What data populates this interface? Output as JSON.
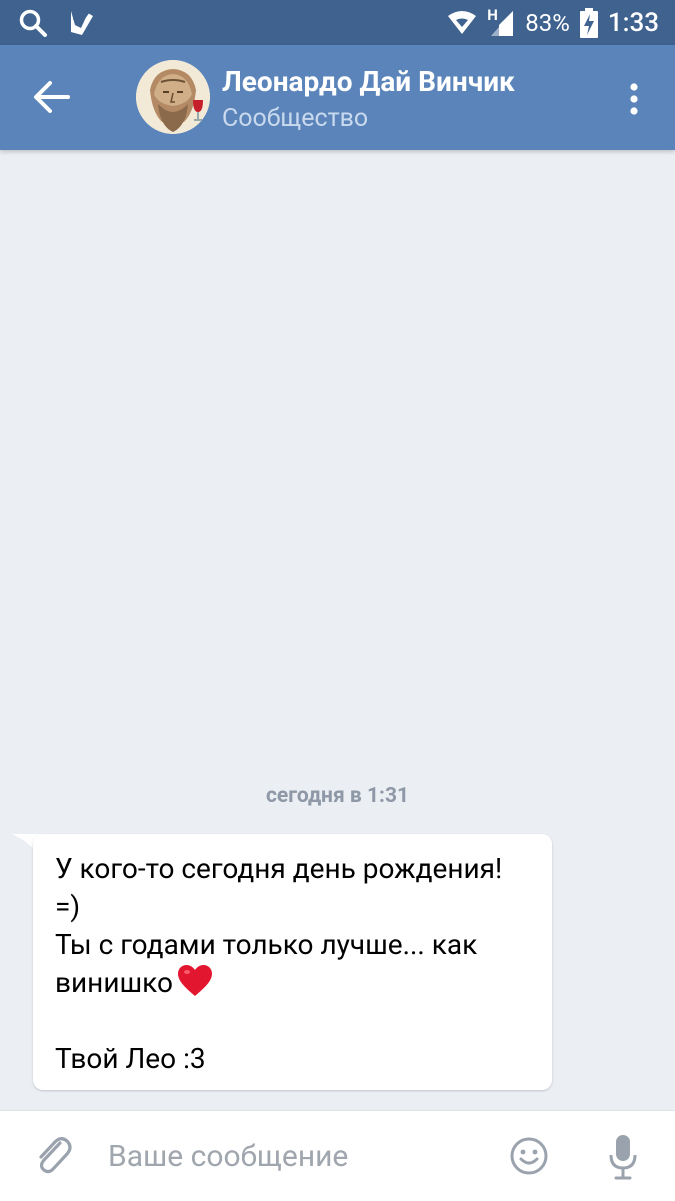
{
  "status_bar": {
    "battery": "83%",
    "time": "1:33",
    "network_label": "H",
    "icons": [
      "search-icon",
      "check-download-icon",
      "wifi-icon",
      "signal-icon",
      "battery-charging-icon"
    ]
  },
  "header": {
    "title": "Леонардо Дай Винчик",
    "subtitle": "Сообщество",
    "back_icon": "arrow-left-icon",
    "menu_icon": "more-vertical-icon"
  },
  "chat": {
    "date_separator": "сегодня в 1:31",
    "messages": [
      {
        "text": "У кого-то сегодня день рождения!\n=)\nТы с годами только лучше... как\nвинишко",
        "text_end": "\n\nТвой Лео :3",
        "emoji": "red-heart"
      }
    ]
  },
  "composer": {
    "placeholder": "Ваше сообщение",
    "value": "",
    "icons": [
      "paperclip-icon",
      "smiley-icon",
      "microphone-icon"
    ]
  },
  "colors": {
    "status_bar": "#3f628f",
    "app_bar": "#5b85ba",
    "chat_background": "#ebeef3",
    "bubble": "#ffffff",
    "heart": "#e3162f"
  }
}
